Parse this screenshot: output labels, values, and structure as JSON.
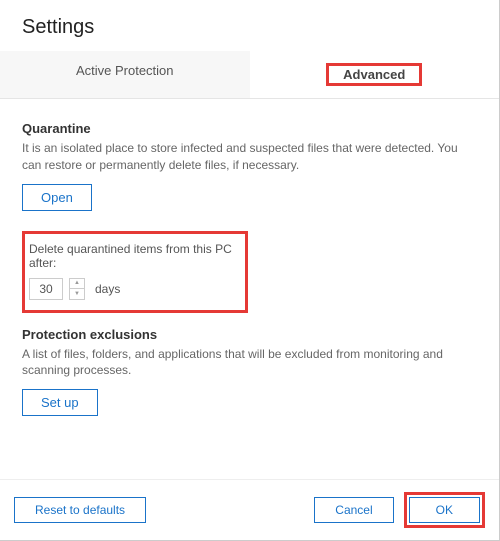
{
  "header": {
    "title": "Settings"
  },
  "tabs": {
    "active_protection": "Active Protection",
    "advanced": "Advanced"
  },
  "quarantine": {
    "title": "Quarantine",
    "desc": "It is an isolated place to store infected and suspected files that were detected. You can restore or permanently delete files, if necessary.",
    "open_label": "Open"
  },
  "delete_section": {
    "label": "Delete quarantined items from this PC after:",
    "value": "30",
    "unit": "days"
  },
  "exclusions": {
    "title": "Protection exclusions",
    "desc": "A list of files, folders, and applications that will be excluded from monitoring and scanning processes.",
    "setup_label": "Set up"
  },
  "footer": {
    "reset_label": "Reset to defaults",
    "cancel_label": "Cancel",
    "ok_label": "OK"
  }
}
